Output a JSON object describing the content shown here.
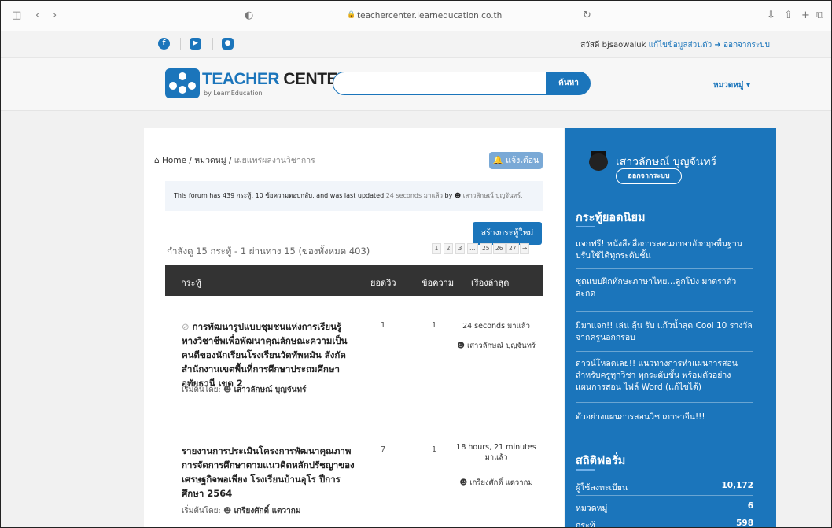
{
  "browser": {
    "url": "teachercenter.learneducation.co.th"
  },
  "topbar": {
    "greeting": "สวัสดี bjsaowaluk",
    "edit_profile": "แก้ไขข้อมูลส่วนตัว",
    "logout": "ออกจากระบบ"
  },
  "header": {
    "logo_text_a": "TEACHER",
    "logo_text_b": " CENTER",
    "logo_sub": "by LearnEducation",
    "search_placeholder": "",
    "search_button": "ค้นหา",
    "category_menu": "หมวดหมู่"
  },
  "breadcrumb": {
    "home": "Home",
    "category": "หมวดหมู่",
    "current": "เผยแพร่ผลงานวิชาการ"
  },
  "notify_button": "แจ้งเตือน",
  "forum_info": {
    "text": "This forum has 439 กระทู้, 10 ข้อความตอบกลับ, and was last updated",
    "time": "24 seconds มาแล้ว",
    "by": "by",
    "user": "เสาวลักษณ์ บุญจันทร์."
  },
  "new_topic_button": "สร้างกระทู้ใหม่",
  "showing_text": "กำลังดู 15 กระทู้ - 1 ผ่านทาง 15 (ของทั้งหมด 403)",
  "pagination": [
    "1",
    "2",
    "3",
    "…",
    "25",
    "26",
    "27",
    "→"
  ],
  "table": {
    "headers": {
      "topic": "กระทู้",
      "views": "ยอดวิว",
      "posts": "ข้อความ",
      "latest": "เรื่องล่าสุด"
    },
    "rows": [
      {
        "title": "การพัฒนารูปแบบชุมชนแห่งการเรียนรู้ทางวิชาชีพเพื่อพัฒนาคุณลักษณะความเป็น คนดีของนักเรียนโรงเรียนวัดทัพหมัน สังกัดสำนักงานเขตพื้นที่การศึกษาประถมศึกษาอุทัยธานี เขต 2",
        "views": "1",
        "posts": "1",
        "latest_time": "24 seconds มาแล้ว",
        "latest_user": "เสาวลักษณ์ บุญจันทร์",
        "started_label": "เริ่มต้นโดย:",
        "started_by": "เสาวลักษณ์ บุญจันทร์"
      },
      {
        "title": "รายงานการประเมินโครงการพัฒนาคุณภาพการจัดการศึกษาตามแนวคิดหลักปรัชญาของเศรษฐกิจพอเพียง โรงเรียนบ้านอุโร ปีการศึกษา 2564",
        "views": "7",
        "posts": "1",
        "latest_time": "18 hours, 21 minutes มาแล้ว",
        "latest_user": "เกรียงศักดิ์ แตวากม",
        "started_label": "เริ่มต้นโดย:",
        "started_by": "เกรียงศักดิ์ แตวากม"
      }
    ]
  },
  "sidebar": {
    "user_name": "เสาวลักษณ์ บุญจันทร์",
    "logout": "ออกจากระบบ",
    "popular_title": "กระทู้ยอดนิยม",
    "popular": [
      "แจกฟรี! หนังสือสื่อการสอนภาษาอังกฤษพื้นฐาน ปรับใช้ได้ทุกระดับชั้น",
      "ชุดแบบฝึกทักษะภาษาไทย…ลูกโป่ง มาตราตัว สะกด",
      "มีมาแจก!! เล่น ลุ้น รับ แก้วน้ำสุด Cool 10 รางวัล จากครูนอกกรอบ",
      "ดาวน์โหลดเลย!! แนวทางการทำแผนการสอนสำหรับครูทุกวิชา ทุกระดับชั้น พร้อมตัวอย่างแผนการสอน ไฟล์ Word (แก้ไขได้)",
      "ตัวอย่างแผนการสอนวิชาภาษาจีน!!!"
    ],
    "stats_title": "สถิติฟอรั่ม",
    "stats": [
      {
        "label": "ผู้ใช้ลงทะเบียน",
        "value": "10,172"
      },
      {
        "label": "หมวดหมู่",
        "value": "6"
      },
      {
        "label": "กระทู้",
        "value": "598"
      }
    ]
  }
}
